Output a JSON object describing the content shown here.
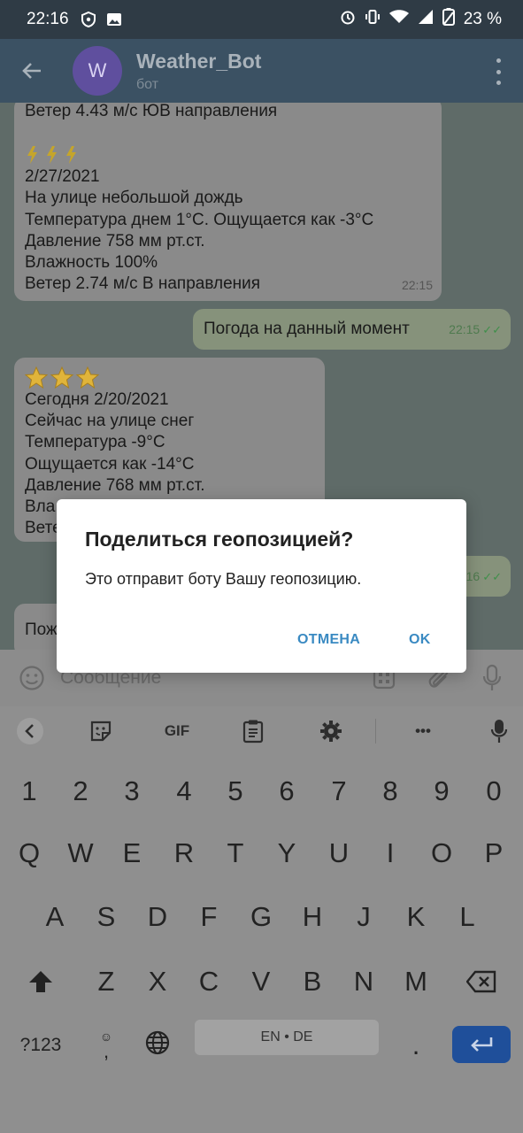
{
  "status_bar": {
    "time": "22:16",
    "battery": "23 %"
  },
  "header": {
    "avatar_letter": "W",
    "title": "Weather_Bot",
    "subtitle": "бот"
  },
  "messages": {
    "m1": {
      "lines": [
        "Ветер 4.43 м/с ЮВ направления",
        "",
        "2/27/2021",
        "На улице небольшой дождь",
        "Температура днем 1°C. Ощущается как -3°C",
        "Давление 758 мм рт.ст.",
        "Влажность 100%",
        "Ветер 2.74 м/с В направления"
      ],
      "emoji": "⚡⚡⚡",
      "time": "22:15"
    },
    "m2": {
      "text": "Погода на данный момент",
      "time": "22:15"
    },
    "m3": {
      "emoji": "⭐⭐⭐",
      "lines": [
        "Сегодня 2/20/2021",
        "Сейчас на улице снег",
        "Температура -9°C",
        "Ощущается как -14°C",
        "Давление 768 мм рт.ст.",
        "Вла",
        "Вете"
      ]
    },
    "m4": {
      "time_partial": "16"
    },
    "m5": {
      "text": "Пож"
    }
  },
  "composer": {
    "placeholder": "Сообщение"
  },
  "keyboard": {
    "toolbar": {
      "gif": "GIF",
      "more": "•••"
    },
    "row_numbers": [
      "1",
      "2",
      "3",
      "4",
      "5",
      "6",
      "7",
      "8",
      "9",
      "0"
    ],
    "row1": [
      "Q",
      "W",
      "E",
      "R",
      "T",
      "Y",
      "U",
      "I",
      "O",
      "P"
    ],
    "row2": [
      "A",
      "S",
      "D",
      "F",
      "G",
      "H",
      "J",
      "K",
      "L"
    ],
    "row3": [
      "Z",
      "X",
      "C",
      "V",
      "B",
      "N",
      "M"
    ],
    "symbols_key": "?123",
    "comma": ",",
    "space_label": "EN • DE",
    "period": "."
  },
  "dialog": {
    "title": "Поделиться геопозицией?",
    "message": "Это отправит боту Вашу геопозицию.",
    "cancel": "ОТМЕНА",
    "ok": "OK"
  },
  "colors": {
    "accent": "#3a8ac2",
    "header_bg": "#3b5163",
    "enter_key": "#1f4f9a"
  }
}
